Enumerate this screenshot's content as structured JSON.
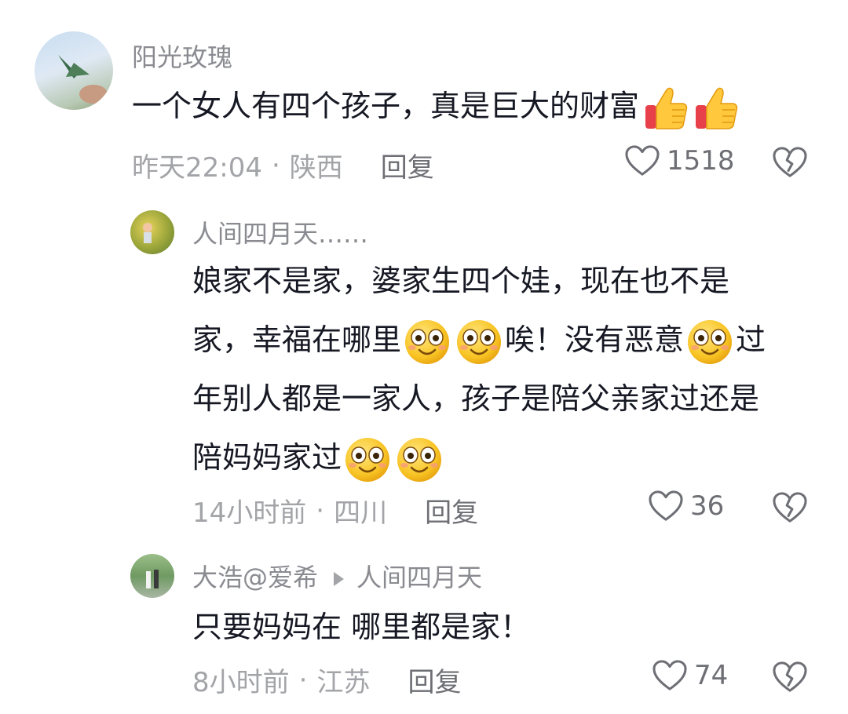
{
  "comments": [
    {
      "username": "阳光玫瑰",
      "text_parts": [
        "一个女人有四个孩子，真是巨大的财富"
      ],
      "time": "昨天22:04",
      "location": "陕西",
      "reply_label": "回复",
      "likes": "1518"
    },
    {
      "username": "人间四月天……",
      "lines": [
        "娘家不是家，婆家生四个娃，现在也不是",
        [
          "家，幸福在哪里",
          "唉！没有恶意",
          "过"
        ],
        "年别人都是一家人，孩子是陪父亲家过还是",
        [
          "陪妈妈家过"
        ]
      ],
      "time": "14小时前",
      "location": "四川",
      "reply_label": "回复",
      "likes": "36"
    },
    {
      "username": "大浩@爱希",
      "reply_to": "人间四月天",
      "text": "只要妈妈在 哪里都是家！",
      "time": "8小时前",
      "location": "江苏",
      "reply_label": "回复",
      "likes": "74"
    }
  ],
  "separator": "·",
  "icons": {
    "like": "heart-outline-icon",
    "dislike": "broken-heart-icon",
    "emoji_thumb": "thumbs-up-emoji",
    "emoji_smile": "smiling-emoji"
  },
  "colors": {
    "text": "#161823",
    "username": "#8a8b91",
    "meta": "#a3a4a8"
  }
}
